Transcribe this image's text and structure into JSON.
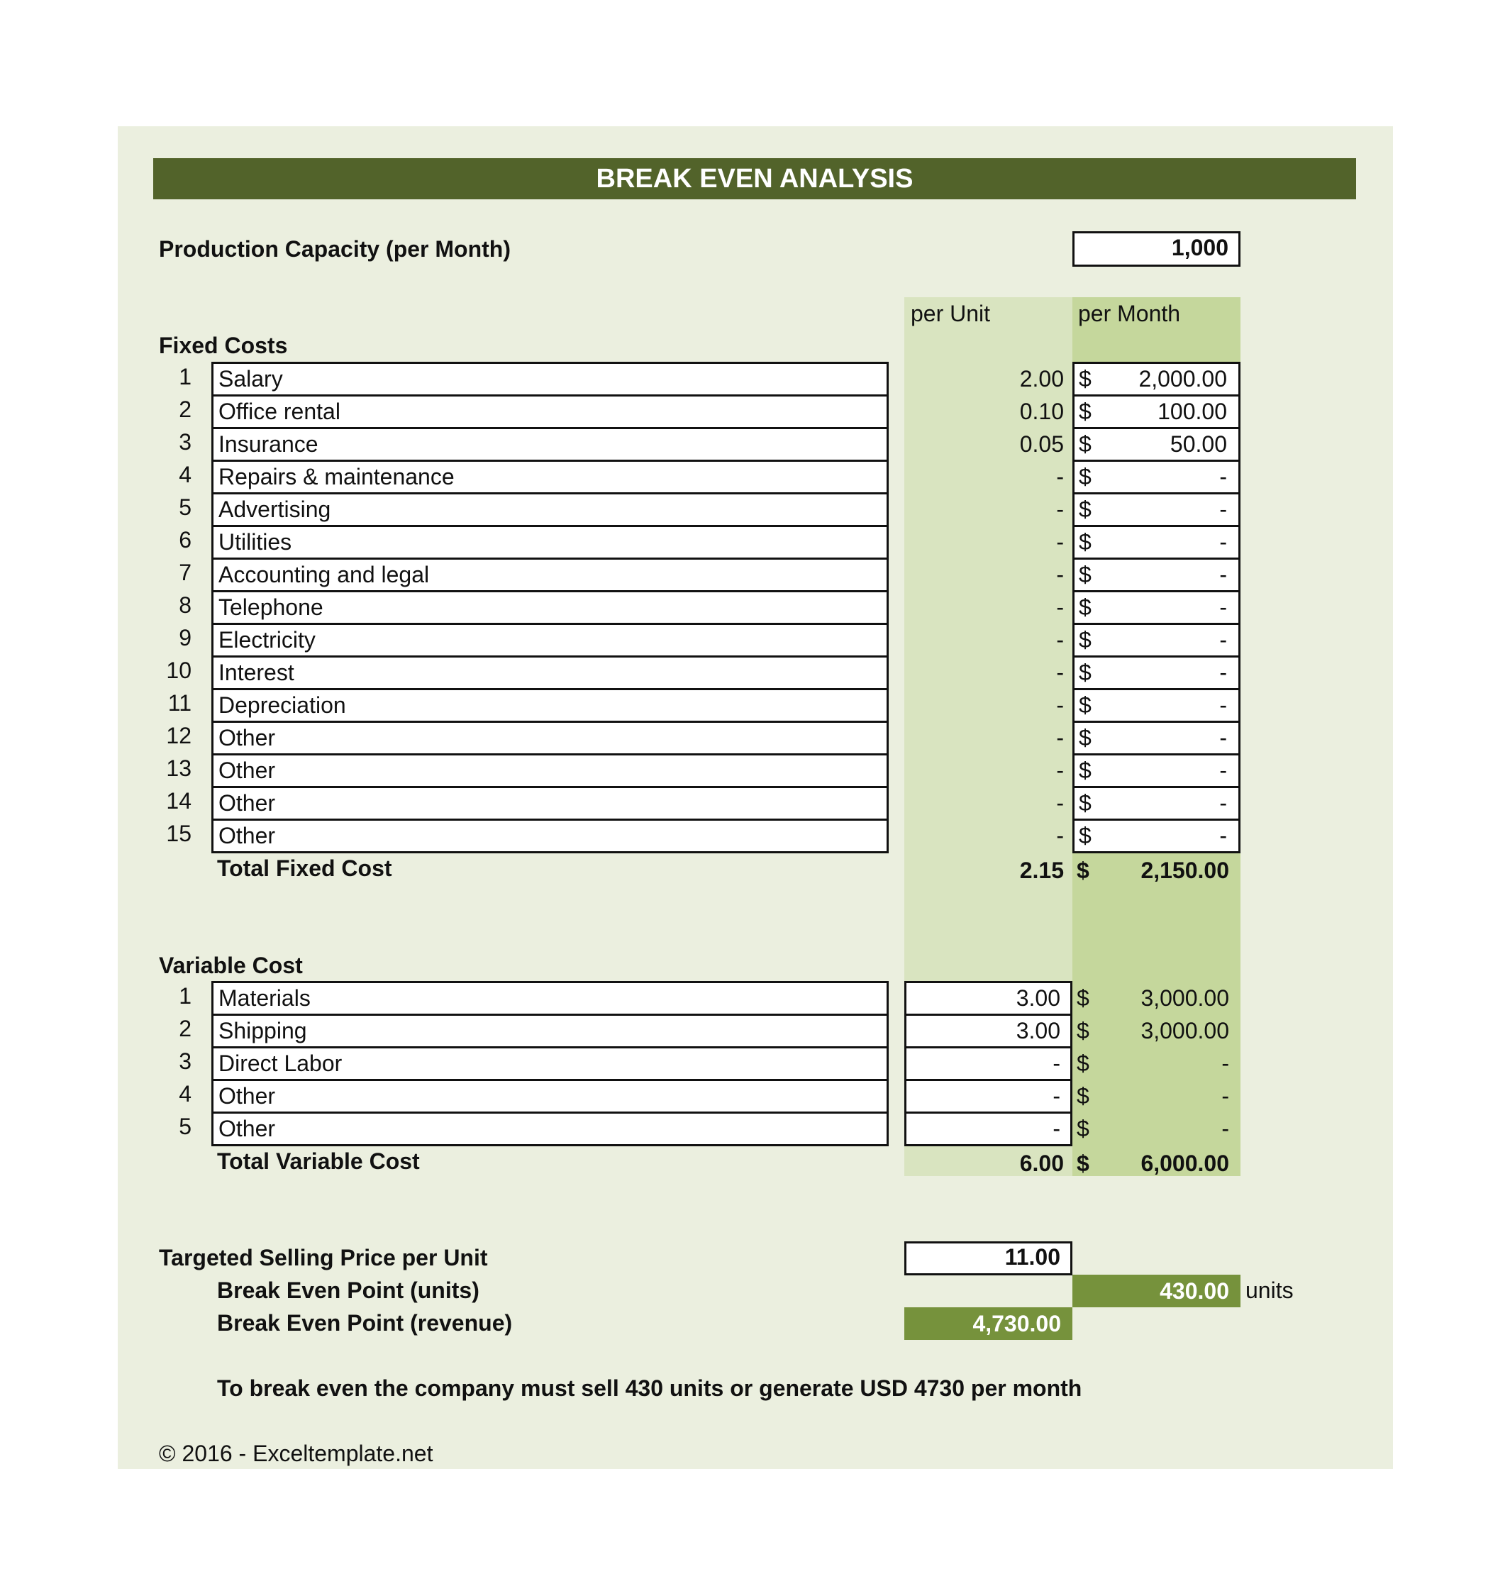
{
  "title": "BREAK EVEN ANALYSIS",
  "production_capacity": {
    "label": "Production Capacity (per Month)",
    "value": "1,000"
  },
  "columns": {
    "per_unit": "per Unit",
    "per_month": "per Month"
  },
  "currency_symbol": "$",
  "fixed_costs": {
    "heading": "Fixed Costs",
    "items": [
      {
        "num": "1",
        "name": "Salary",
        "per_unit": "2.00",
        "per_month": "2,000.00"
      },
      {
        "num": "2",
        "name": "Office rental",
        "per_unit": "0.10",
        "per_month": "100.00"
      },
      {
        "num": "3",
        "name": "Insurance",
        "per_unit": "0.05",
        "per_month": "50.00"
      },
      {
        "num": "4",
        "name": "Repairs & maintenance",
        "per_unit": "-",
        "per_month": "-"
      },
      {
        "num": "5",
        "name": "Advertising",
        "per_unit": "-",
        "per_month": "-"
      },
      {
        "num": "6",
        "name": "Utilities",
        "per_unit": "-",
        "per_month": "-"
      },
      {
        "num": "7",
        "name": "Accounting and legal",
        "per_unit": "-",
        "per_month": "-"
      },
      {
        "num": "8",
        "name": "Telephone",
        "per_unit": "-",
        "per_month": "-"
      },
      {
        "num": "9",
        "name": "Electricity",
        "per_unit": "-",
        "per_month": "-"
      },
      {
        "num": "10",
        "name": "Interest",
        "per_unit": "-",
        "per_month": "-"
      },
      {
        "num": "11",
        "name": "Depreciation",
        "per_unit": "-",
        "per_month": "-"
      },
      {
        "num": "12",
        "name": "Other",
        "per_unit": "-",
        "per_month": "-"
      },
      {
        "num": "13",
        "name": "Other",
        "per_unit": "-",
        "per_month": "-"
      },
      {
        "num": "14",
        "name": "Other",
        "per_unit": "-",
        "per_month": "-"
      },
      {
        "num": "15",
        "name": "Other",
        "per_unit": "-",
        "per_month": "-"
      }
    ],
    "total_label": "Total Fixed Cost",
    "total_per_unit": "2.15",
    "total_per_month": "2,150.00"
  },
  "variable_costs": {
    "heading": "Variable Cost",
    "items": [
      {
        "num": "1",
        "name": "Materials",
        "per_unit": "3.00",
        "per_month": "3,000.00"
      },
      {
        "num": "2",
        "name": "Shipping",
        "per_unit": "3.00",
        "per_month": "3,000.00"
      },
      {
        "num": "3",
        "name": "Direct Labor",
        "per_unit": "-",
        "per_month": "-"
      },
      {
        "num": "4",
        "name": "Other",
        "per_unit": "-",
        "per_month": "-"
      },
      {
        "num": "5",
        "name": "Other",
        "per_unit": "-",
        "per_month": "-"
      }
    ],
    "total_label": "Total Variable Cost",
    "total_per_unit": "6.00",
    "total_per_month": "6,000.00"
  },
  "selling_price": {
    "label": "Targeted Selling Price per Unit",
    "value": "11.00"
  },
  "break_even_units": {
    "label": "Break Even Point (units)",
    "value": "430.00",
    "suffix": "units"
  },
  "break_even_revenue": {
    "label": "Break Even Point (revenue)",
    "value": "4,730.00"
  },
  "summary": "To break even the company must sell 430 units or generate USD 4730 per month",
  "copyright": "© 2016 - Exceltemplate.net",
  "colors": {
    "panel_bg": "#ebefdf",
    "title_bar": "#52632a",
    "per_unit_col": "#d9e4c0",
    "per_month_col": "#c5d79c",
    "result_fill": "#76923c"
  }
}
